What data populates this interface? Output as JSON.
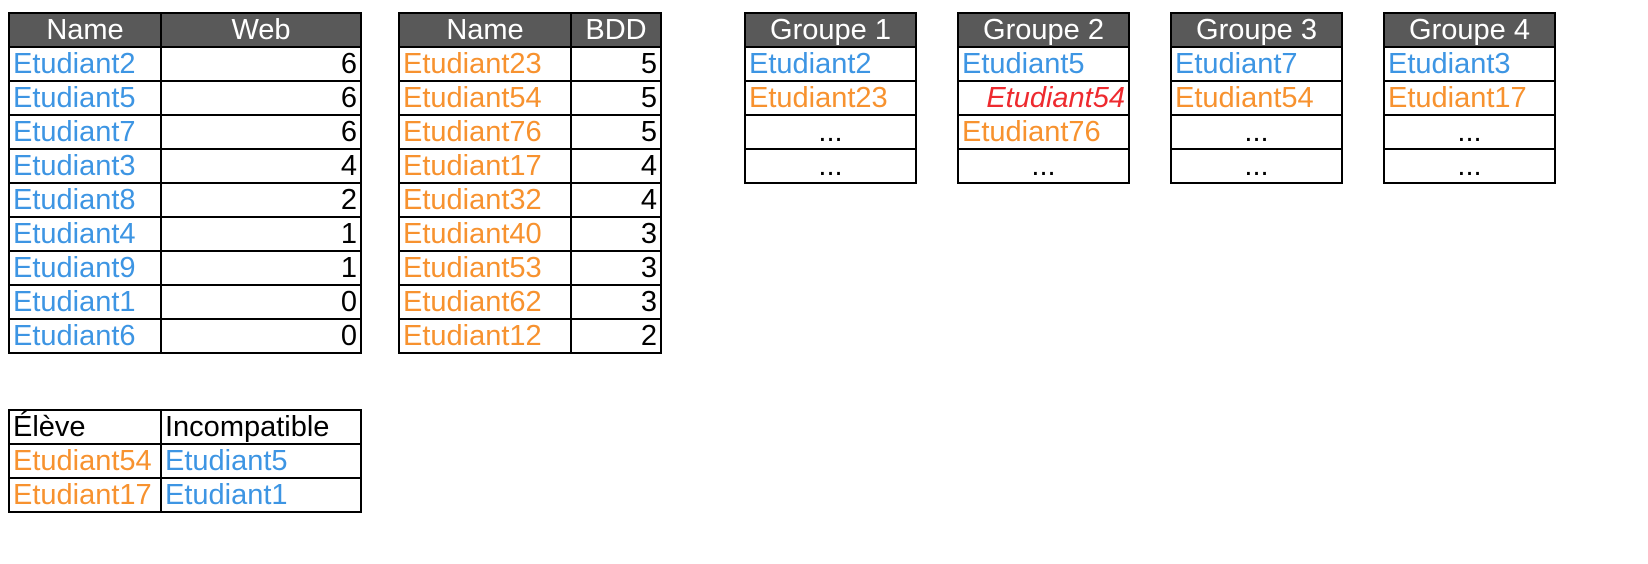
{
  "colors": {
    "header_bg": "#595959",
    "header_text": "#ffffff",
    "blue": "#3d95e3",
    "orange": "#f7922f",
    "red": "#ee2a2f",
    "border": "#000000"
  },
  "web_table": {
    "headers": [
      "Name",
      "Web"
    ],
    "rows": [
      {
        "name": "Etudiant2",
        "value": "6"
      },
      {
        "name": "Etudiant5",
        "value": "6"
      },
      {
        "name": "Etudiant7",
        "value": "6"
      },
      {
        "name": "Etudiant3",
        "value": "4"
      },
      {
        "name": "Etudiant8",
        "value": "2"
      },
      {
        "name": "Etudiant4",
        "value": "1"
      },
      {
        "name": "Etudiant9",
        "value": "1"
      },
      {
        "name": "Etudiant1",
        "value": "0"
      },
      {
        "name": "Etudiant6",
        "value": "0"
      }
    ]
  },
  "bdd_table": {
    "headers": [
      "Name",
      "BDD"
    ],
    "rows": [
      {
        "name": "Etudiant23",
        "value": "5"
      },
      {
        "name": "Etudiant54",
        "value": "5"
      },
      {
        "name": "Etudiant76",
        "value": "5"
      },
      {
        "name": "Etudiant17",
        "value": "4"
      },
      {
        "name": "Etudiant32",
        "value": "4"
      },
      {
        "name": "Etudiant40",
        "value": "3"
      },
      {
        "name": "Etudiant53",
        "value": "3"
      },
      {
        "name": "Etudiant62",
        "value": "3"
      },
      {
        "name": "Etudiant12",
        "value": "2"
      }
    ]
  },
  "incompat_table": {
    "headers": [
      "Élève",
      "Incompatible"
    ],
    "rows": [
      {
        "eleve": "Etudiant54",
        "incompatible": "Etudiant5"
      },
      {
        "eleve": "Etudiant17",
        "incompatible": "Etudiant1"
      }
    ]
  },
  "groups": [
    {
      "title": "Groupe 1",
      "cells": [
        "Etudiant2",
        "Etudiant23",
        "...",
        "..."
      ]
    },
    {
      "title": "Groupe 2",
      "cells": [
        "Etudiant5",
        "Etudiant54",
        "Etudiant76",
        "..."
      ]
    },
    {
      "title": "Groupe 3",
      "cells": [
        "Etudiant7",
        "Etudiant54",
        "...",
        "..."
      ]
    },
    {
      "title": "Groupe 4",
      "cells": [
        "Etudiant3",
        "Etudiant17",
        "...",
        "..."
      ]
    }
  ]
}
